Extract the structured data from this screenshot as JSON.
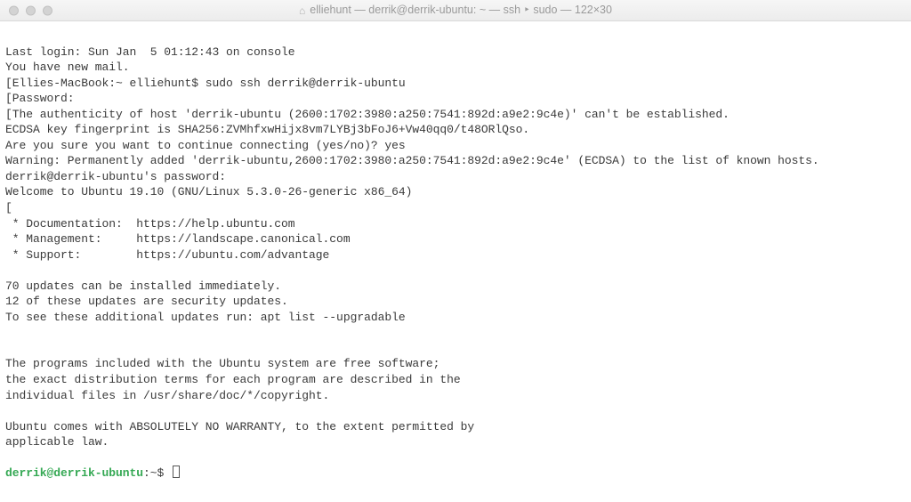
{
  "titlebar": {
    "icon": "home-icon",
    "text": "elliehunt — derrik@derrik-ubuntu: ~ — ssh ‣ sudo — 122×30"
  },
  "terminal": {
    "lines": [
      "Last login: Sun Jan  5 01:12:43 on console",
      "You have new mail.",
      "[Ellies-MacBook:~ elliehunt$ sudo ssh derrik@derrik-ubuntu",
      "[Password:",
      "[The authenticity of host 'derrik-ubuntu (2600:1702:3980:a250:7541:892d:a9e2:9c4e)' can't be established.",
      "ECDSA key fingerprint is SHA256:ZVMhfxwHijx8vm7LYBj3bFoJ6+Vw40qq0/t48ORlQso.",
      "Are you sure you want to continue connecting (yes/no)? yes",
      "Warning: Permanently added 'derrik-ubuntu,2600:1702:3980:a250:7541:892d:a9e2:9c4e' (ECDSA) to the list of known hosts.",
      "derrik@derrik-ubuntu's password:",
      "Welcome to Ubuntu 19.10 (GNU/Linux 5.3.0-26-generic x86_64)",
      "[",
      " * Documentation:  https://help.ubuntu.com",
      " * Management:     https://landscape.canonical.com",
      " * Support:        https://ubuntu.com/advantage",
      "",
      "70 updates can be installed immediately.",
      "12 of these updates are security updates.",
      "To see these additional updates run: apt list --upgradable",
      "",
      "",
      "The programs included with the Ubuntu system are free software;",
      "the exact distribution terms for each program are described in the",
      "individual files in /usr/share/doc/*/copyright.",
      "",
      "Ubuntu comes with ABSOLUTELY NO WARRANTY, to the extent permitted by",
      "applicable law.",
      ""
    ],
    "prompt": {
      "user_host": "derrik@derrik-ubuntu",
      "path_symbol": ":~$ "
    }
  }
}
